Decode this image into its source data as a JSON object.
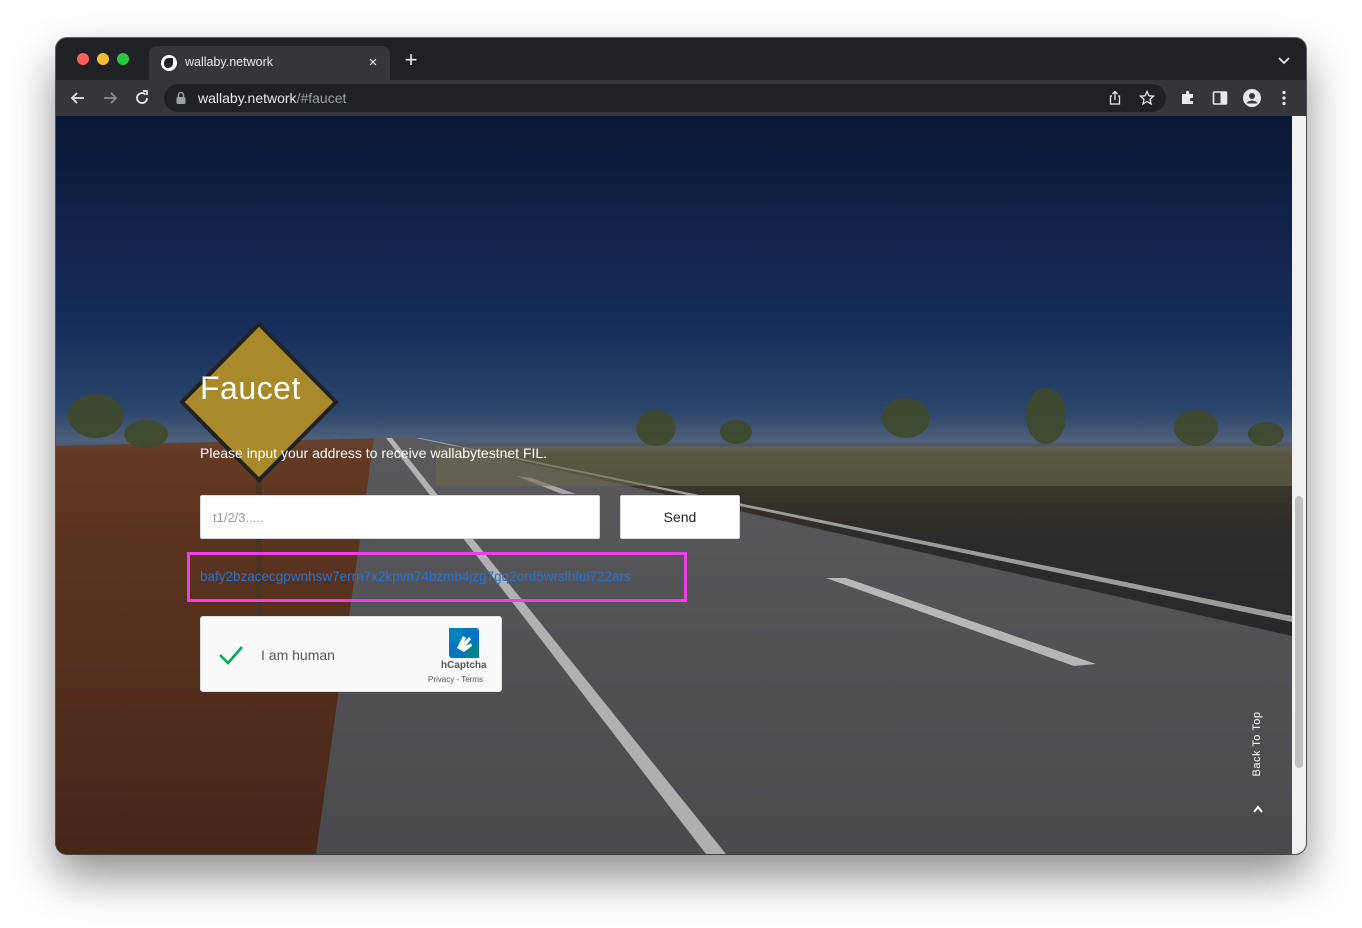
{
  "browser": {
    "tab_title": "wallaby.network",
    "tab_close": "×",
    "new_tab": "+",
    "url_host": "wallaby.network",
    "url_path": "/#faucet"
  },
  "page": {
    "title": "Faucet",
    "subtitle": "Please input your address to receive wallabytestnet FIL.",
    "address_input": {
      "placeholder": "t1/2/3.....",
      "value": ""
    },
    "send_label": "Send",
    "cid_link": "bafy2bzacecgpwnhsw7errn7x2kpvn74bzmb4jzg7gq2ord5wrslhful722ars",
    "captcha": {
      "label": "I am human",
      "brand": "hCaptcha",
      "links": "Privacy - Terms",
      "checked": true
    },
    "back_to_top": "Back To Top"
  },
  "colors": {
    "highlight_border": "#ea40e4",
    "link": "#2a73c9",
    "check": "#00a95a"
  }
}
